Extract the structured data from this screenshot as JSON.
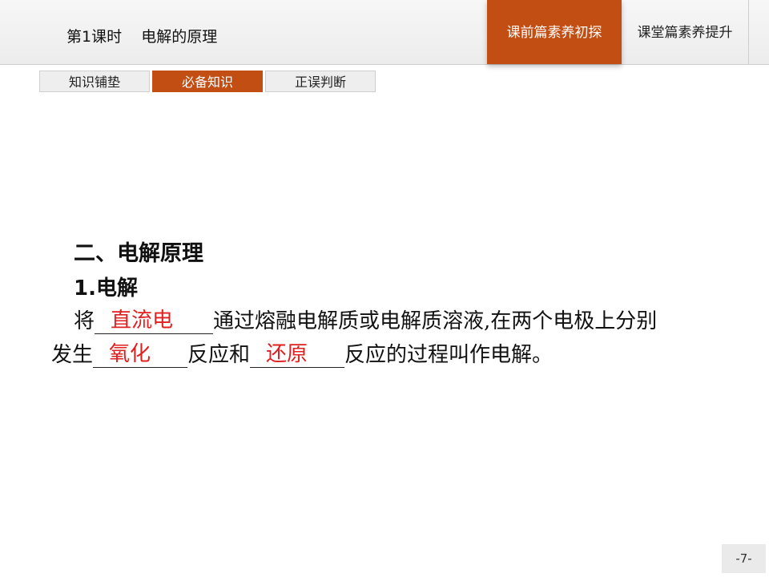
{
  "header": {
    "lesson_title": "第1课时    电解的原理",
    "nav_tabs": [
      {
        "label": "课前篇素养初探",
        "active": true
      },
      {
        "label": "课堂篇素养提升",
        "active": false
      }
    ]
  },
  "subtabs": [
    {
      "label": "知识铺垫",
      "active": false
    },
    {
      "label": "必备知识",
      "active": true
    },
    {
      "label": "正误判断",
      "active": false
    }
  ],
  "content": {
    "section_heading": "二、电解原理",
    "sub_heading": "1.电解",
    "line1_prefix": "将",
    "blank1_answer": "直流电",
    "line1_suffix": "通过熔融电解质或电解质溶液,在两个电极上分别",
    "line2_prefix": "发生",
    "blank2_answer": "氧化",
    "line2_middle": "反应和",
    "blank3_answer": "还原",
    "line2_suffix": "反应的过程叫作电解。"
  },
  "colors": {
    "accent": "#c24e13",
    "answer": "#e02020"
  },
  "page_number": "-7-"
}
